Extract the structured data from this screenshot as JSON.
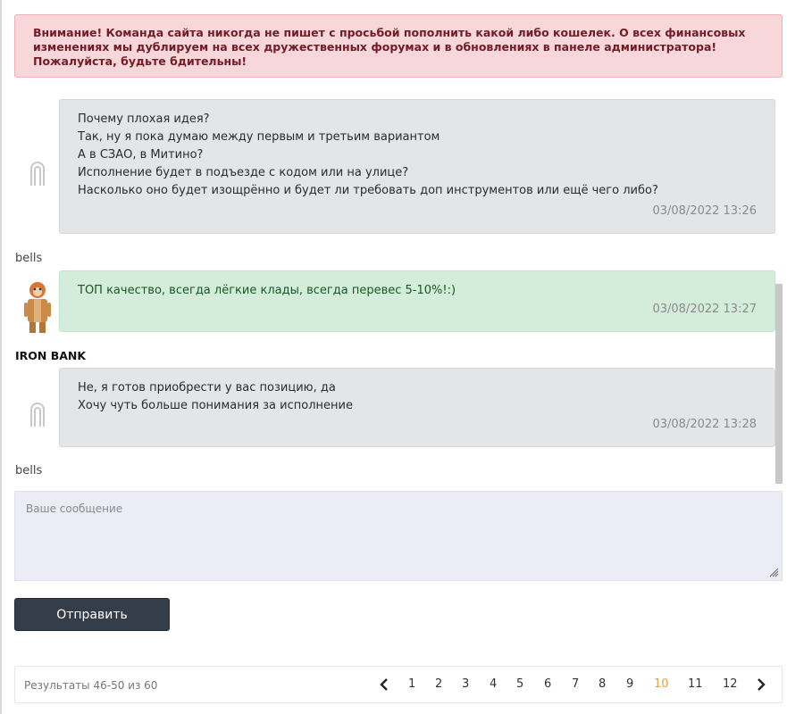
{
  "alert": {
    "text": "Внимание! Команда сайта никогда не пишет с просьбой пополнить какой либо кошелек. О всех финансовых изменениях мы дублируем на всех дружественных форумах и в обновлениях в панеле администратора! Пожалуйста, будьте бдительны!"
  },
  "messages": [
    {
      "lines": [
        "Почему плохая идея?",
        "Так, ну я пока думаю между первым и третьим вариантом",
        "А в СЗАО, в Митино?",
        "Исполнение будет в подъезде с кодом или на улице?",
        "Насколько оно будет изощрённо и будет ли требовать доп инструментов или ещё чего либо?"
      ],
      "time": "03/08/2022 13:26",
      "author": "bells",
      "style": "gray"
    },
    {
      "lines": [
        "ТОП качество, всегда лёгкие клады, всегда перевес 5-10%!:)"
      ],
      "time": "03/08/2022 13:27",
      "author": "IRON BANK",
      "style": "green"
    },
    {
      "lines": [
        "Не, я готов приобрести у вас позицию, да",
        "Хочу чуть больше понимания за исполнение"
      ],
      "time": "03/08/2022 13:28",
      "author": "bells",
      "style": "gray"
    }
  ],
  "composer": {
    "placeholder": "Ваше сообщение",
    "send_label": "Отправить"
  },
  "pagination": {
    "results_text": "Результаты 46-50 из 60",
    "pages": [
      "1",
      "2",
      "3",
      "4",
      "5",
      "6",
      "7",
      "8",
      "9",
      "10",
      "11",
      "12"
    ],
    "current": "10",
    "accent": "#e8a042"
  },
  "colors": {
    "alert_bg": "#f8d7da",
    "alert_text": "#721c24",
    "bubble_gray": "#e4e5e7",
    "bubble_green": "#d4edda",
    "button_bg": "#353c4a",
    "composer_bg": "#ebecf6"
  },
  "icons": {
    "default_avatar": "placeholder-avatar-icon",
    "seller_avatar": "cartoon-character-avatar",
    "prev": "chevron-left-icon",
    "next": "chevron-right-icon",
    "resize": "resize-grip-icon"
  }
}
